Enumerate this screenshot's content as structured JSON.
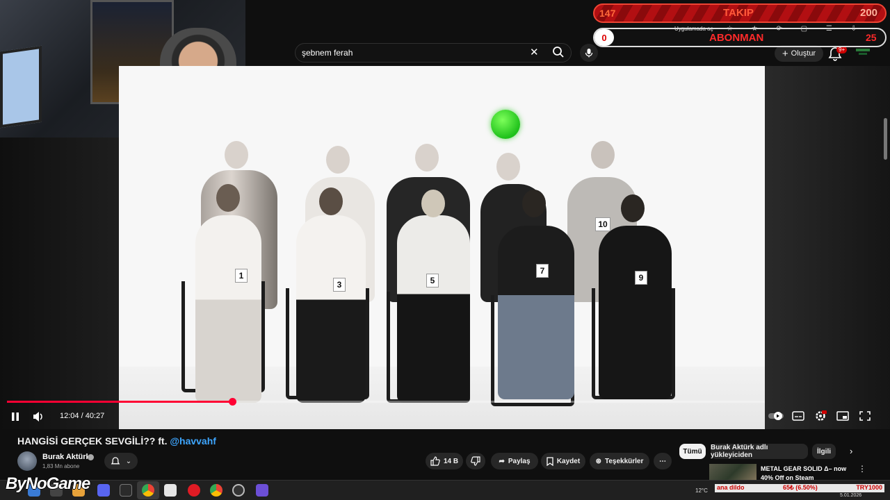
{
  "overlay": {
    "takip_label": "TAKIP",
    "takip_current": "147",
    "takip_goal": "200",
    "abonman_label": "ABONMAN",
    "abonman_current": "0",
    "abonman_goal": "25",
    "browser_hint": "Uygulamada aç",
    "brand": "ByNoGame"
  },
  "topbar": {
    "search_value": "şebnem ferah",
    "create_label": "Oluştur",
    "notif_count": "9+"
  },
  "player": {
    "current_time": "12:04",
    "duration": "40:27",
    "time_display": "12:04 / 40:27",
    "progress_fraction": 0.2976,
    "tags": [
      "1",
      "3",
      "5",
      "7",
      "9",
      "10"
    ]
  },
  "video_info": {
    "title_prefix": "HANGİSİ GERÇEK SEVGİLİ?? ft. ",
    "title_mention": "@havvahf",
    "channel_name": "Burak Aktürk",
    "subscribers": "1,83 Mn abone",
    "likes": "14 B",
    "share_label": "Paylaş",
    "save_label": "Kaydet",
    "thanks_label": "Teşekkürler"
  },
  "sidebar": {
    "chips": [
      "Tümü",
      "Burak Aktürk adlı yükleyiciden",
      "İlgili"
    ],
    "ad_title": "METAL GEAR SOLID Δ– now 40% Off on Steam"
  },
  "taskbar": {
    "temperature": "12°C",
    "ticker_left": "ana dildo",
    "ticker_mid": "65₺ (6.50%)",
    "ticker_right": "TRY1000",
    "date": "5.01.2026"
  },
  "colors": {
    "accent_red": "#ff0033",
    "mention_blue": "#3ea6ff",
    "overlay_red": "#b20f12"
  }
}
